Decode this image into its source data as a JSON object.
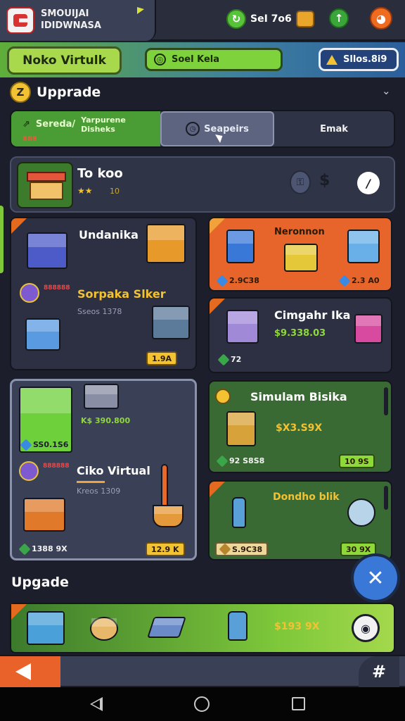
{
  "header": {
    "logo_line1": "SMOUIJAI",
    "logo_line2": "IDIDWNASA",
    "coins": "SeI 7o6",
    "plus_icon": "plus-icon",
    "profile_icon": "tomato-icon"
  },
  "banner": {
    "title": "Noko Virtulk",
    "search_placeholder": "Soel Kela",
    "balance": "Sllos.8i9"
  },
  "section": {
    "title": "Upprade",
    "icon_label": "Z"
  },
  "tabs": [
    {
      "label": "Sereda/",
      "detail": "Yarpurene Disheks",
      "sub": "888"
    },
    {
      "label": "Seapeirs"
    },
    {
      "label": "Emak"
    }
  ],
  "toko": {
    "title": "To koo",
    "stars": "★★",
    "level": "10"
  },
  "cards": {
    "undanika": {
      "title": "Undanika"
    },
    "sorpaka": {
      "tag": "888888",
      "title": "Sorpaka Slker",
      "sub": "Sseos 1378",
      "price": "1.9A"
    },
    "neronnon": {
      "title": "Neronnon",
      "cost_left": "2.9C38",
      "cost_right": "2.3 A0"
    },
    "cimgah": {
      "title": "Cimgahr Ika",
      "price": "$9.338.03",
      "cost": "72"
    },
    "shop_left": {
      "price": "K$ 390.800",
      "cost": "SS0.1S6"
    },
    "ciko": {
      "tag": "888888",
      "title": "Ciko Virtual",
      "sub": "Kreos 1309",
      "cost": "1388 9X",
      "price": "12.9 K"
    },
    "simulam": {
      "title": "Simulam Bisika",
      "price": "$X3.S9X",
      "cost": "92 S8S8",
      "chip": "10 9S"
    },
    "dondho": {
      "title": "Dondho blik",
      "cost": "S.9C38",
      "chip": "30 9X"
    }
  },
  "upgrade": {
    "title": "Upgade",
    "price": "$193 9X"
  },
  "colors": {
    "background": "#1c1f2b",
    "accent_green": "#7ed33c",
    "accent_orange": "#e36a1f",
    "gold": "#f2c232"
  }
}
